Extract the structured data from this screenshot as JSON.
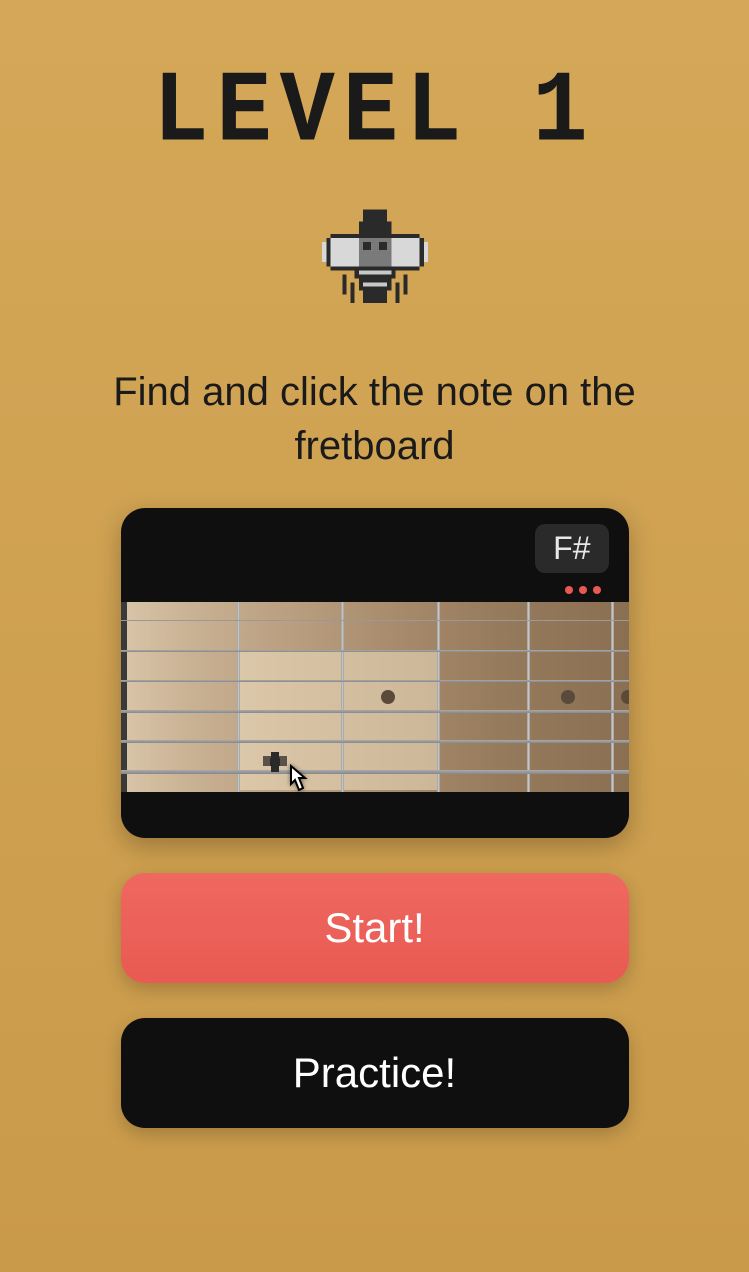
{
  "title": "LEVEL 1",
  "icon": "fly-icon",
  "instruction": "Find and click the note on the fretboard",
  "preview": {
    "note_label": "F#"
  },
  "buttons": {
    "start": "Start!",
    "practice": "Practice!"
  }
}
